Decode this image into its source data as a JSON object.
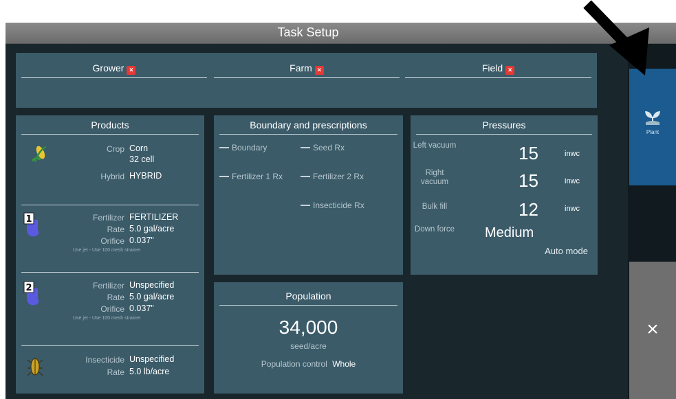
{
  "window": {
    "title": "Task Setup"
  },
  "selection": {
    "grower_label": "Grower",
    "farm_label": "Farm",
    "field_label": "Field",
    "required_marker": "×"
  },
  "products": {
    "header": "Products",
    "crop": {
      "label": "Crop",
      "value": "Corn",
      "sub": "32 cell"
    },
    "hybrid": {
      "label": "Hybrid",
      "value": "HYBRID"
    },
    "fertilizer1": {
      "badge": "1",
      "fert_label": "Fertilizer",
      "fert_value": "FERTILIZER",
      "rate_label": "Rate",
      "rate_value": "5.0 gal/acre",
      "orifice_label": "Orifice",
      "orifice_value": "0.037\"",
      "note": "Use jet - Use 100 mesh strainer"
    },
    "fertilizer2": {
      "badge": "2",
      "fert_label": "Fertilizer",
      "fert_value": "Unspecified",
      "rate_label": "Rate",
      "rate_value": "5.0 gal/acre",
      "orifice_label": "Orifice",
      "orifice_value": "0.037\"",
      "note": "Use jet - Use 100 mesh strainer"
    },
    "insecticide": {
      "label": "Insecticide",
      "value": "Unspecified",
      "rate_label": "Rate",
      "rate_value": "5.0 lb/acre"
    }
  },
  "boundary": {
    "header": "Boundary and prescriptions",
    "items": [
      "Boundary",
      "Seed Rx",
      "Fertilizer 1 Rx",
      "Fertilizer 2 Rx",
      "Insecticide Rx"
    ]
  },
  "population": {
    "header": "Population",
    "value": "34,000",
    "unit": "seed/acre",
    "control_label": "Population control",
    "control_value": "Whole"
  },
  "pressures": {
    "header": "Pressures",
    "left_vacuum_label": "Left vacuum",
    "left_vacuum_value": "15",
    "left_vacuum_unit": "inwc",
    "right_vacuum_label": "Right vacuum",
    "right_vacuum_value": "15",
    "right_vacuum_unit": "inwc",
    "bulk_fill_label": "Bulk fill",
    "bulk_fill_value": "12",
    "bulk_fill_unit": "inwc",
    "down_force_label": "Down force",
    "down_force_value": "Medium",
    "mode": "Auto mode"
  },
  "sidebar": {
    "plant_label": "Plant",
    "close_symbol": "×"
  },
  "colors": {
    "panel": "#3b5b69",
    "background": "#19272d",
    "plant_button": "#1b5b8f",
    "close_button": "#6f6f6f",
    "required": "#e53935"
  }
}
